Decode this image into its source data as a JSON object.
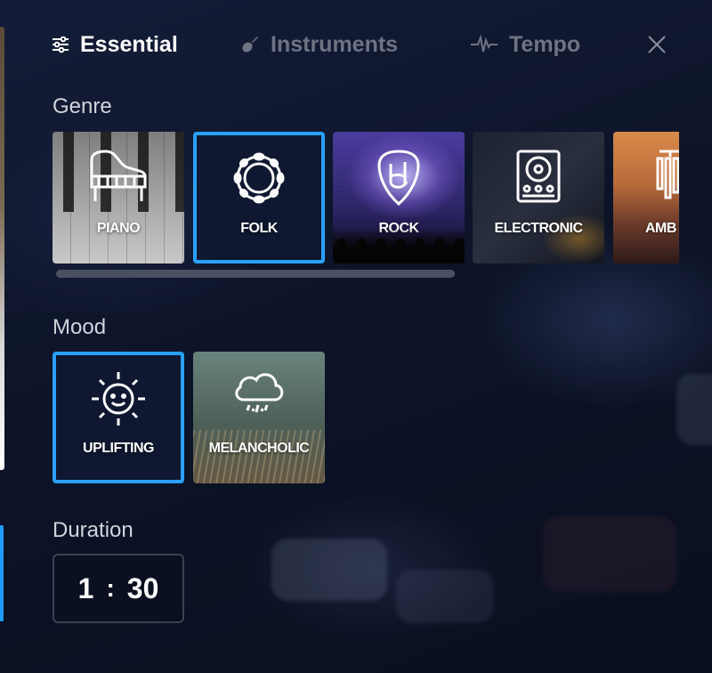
{
  "tabs": [
    {
      "label": "Essential",
      "icon": "sliders-icon",
      "active": true
    },
    {
      "label": "Instruments",
      "icon": "guitar-icon",
      "active": false
    },
    {
      "label": "Tempo",
      "icon": "waveform-icon",
      "active": false
    }
  ],
  "sections": {
    "genre_label": "Genre",
    "mood_label": "Mood",
    "duration_label": "Duration"
  },
  "genres": [
    {
      "label": "PIANO",
      "icon": "grand-piano-icon",
      "selected": false
    },
    {
      "label": "FOLK",
      "icon": "tambourine-icon",
      "selected": true
    },
    {
      "label": "ROCK",
      "icon": "rock-hand-pick-icon",
      "selected": false
    },
    {
      "label": "ELECTRONIC",
      "icon": "dj-mixer-icon",
      "selected": false
    },
    {
      "label": "AMB",
      "icon": "wind-chime-icon",
      "selected": false
    }
  ],
  "moods": [
    {
      "label": "UPLIFTING",
      "icon": "smiling-sun-icon",
      "selected": true
    },
    {
      "label": "MELANCHOLIC",
      "icon": "rain-cloud-icon",
      "selected": false
    }
  ],
  "duration": {
    "minutes": "1",
    "separator": ":",
    "seconds": "30"
  },
  "colors": {
    "accent": "#2aa0ff",
    "inactive_tab": "#6e7484",
    "background": "#0d1429"
  }
}
